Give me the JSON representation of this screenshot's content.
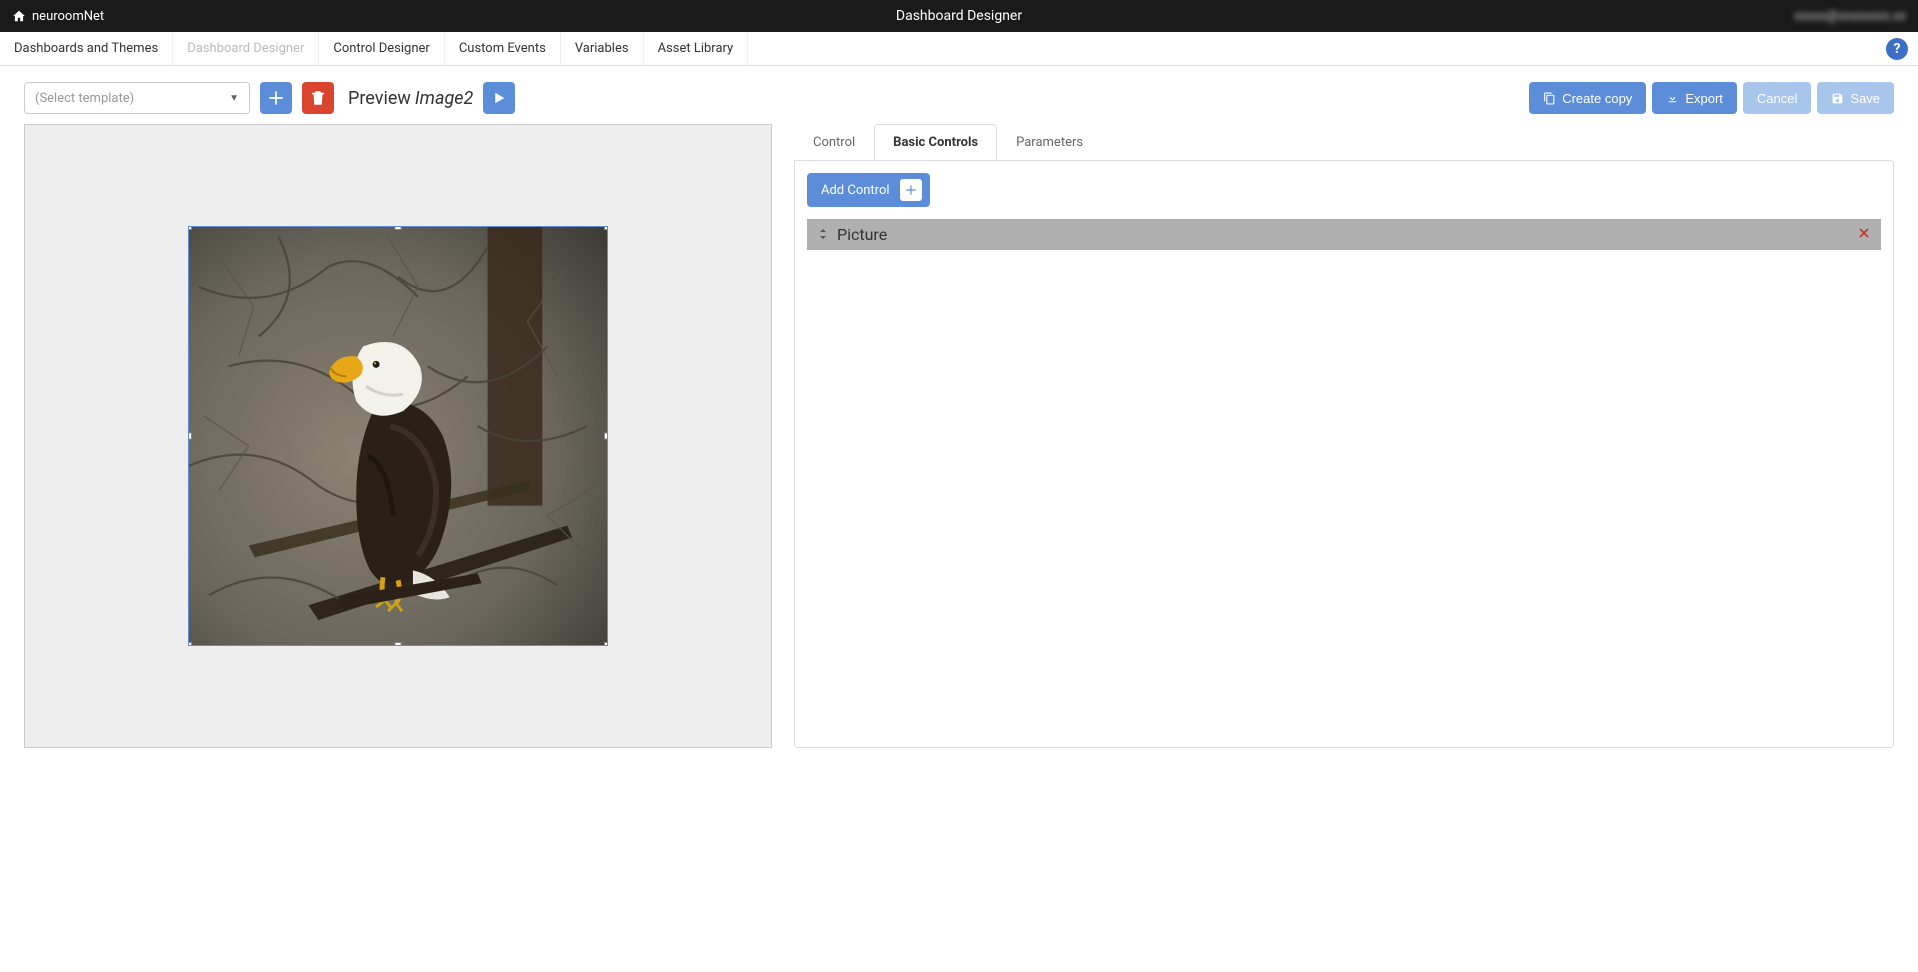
{
  "topbar": {
    "brand": "neuroomNet",
    "title": "Dashboard Designer",
    "user": "xxxxx@xxxxxxxx.xx"
  },
  "nav": {
    "items": [
      {
        "label": "Dashboards and Themes",
        "state": "enabled"
      },
      {
        "label": "Dashboard Designer",
        "state": "disabled"
      },
      {
        "label": "Control Designer",
        "state": "enabled"
      },
      {
        "label": "Custom Events",
        "state": "enabled"
      },
      {
        "label": "Variables",
        "state": "enabled"
      },
      {
        "label": "Asset Library",
        "state": "enabled"
      }
    ]
  },
  "toolbar": {
    "template_placeholder": "(Select template)",
    "preview_label": "Preview",
    "preview_name": "Image2",
    "create_copy": "Create copy",
    "export": "Export",
    "cancel": "Cancel",
    "save": "Save"
  },
  "sidepanel": {
    "tabs": [
      "Control",
      "Basic Controls",
      "Parameters"
    ],
    "active_tab": "Basic Controls",
    "add_control_label": "Add Control",
    "controls": [
      {
        "type": "Picture"
      }
    ]
  }
}
